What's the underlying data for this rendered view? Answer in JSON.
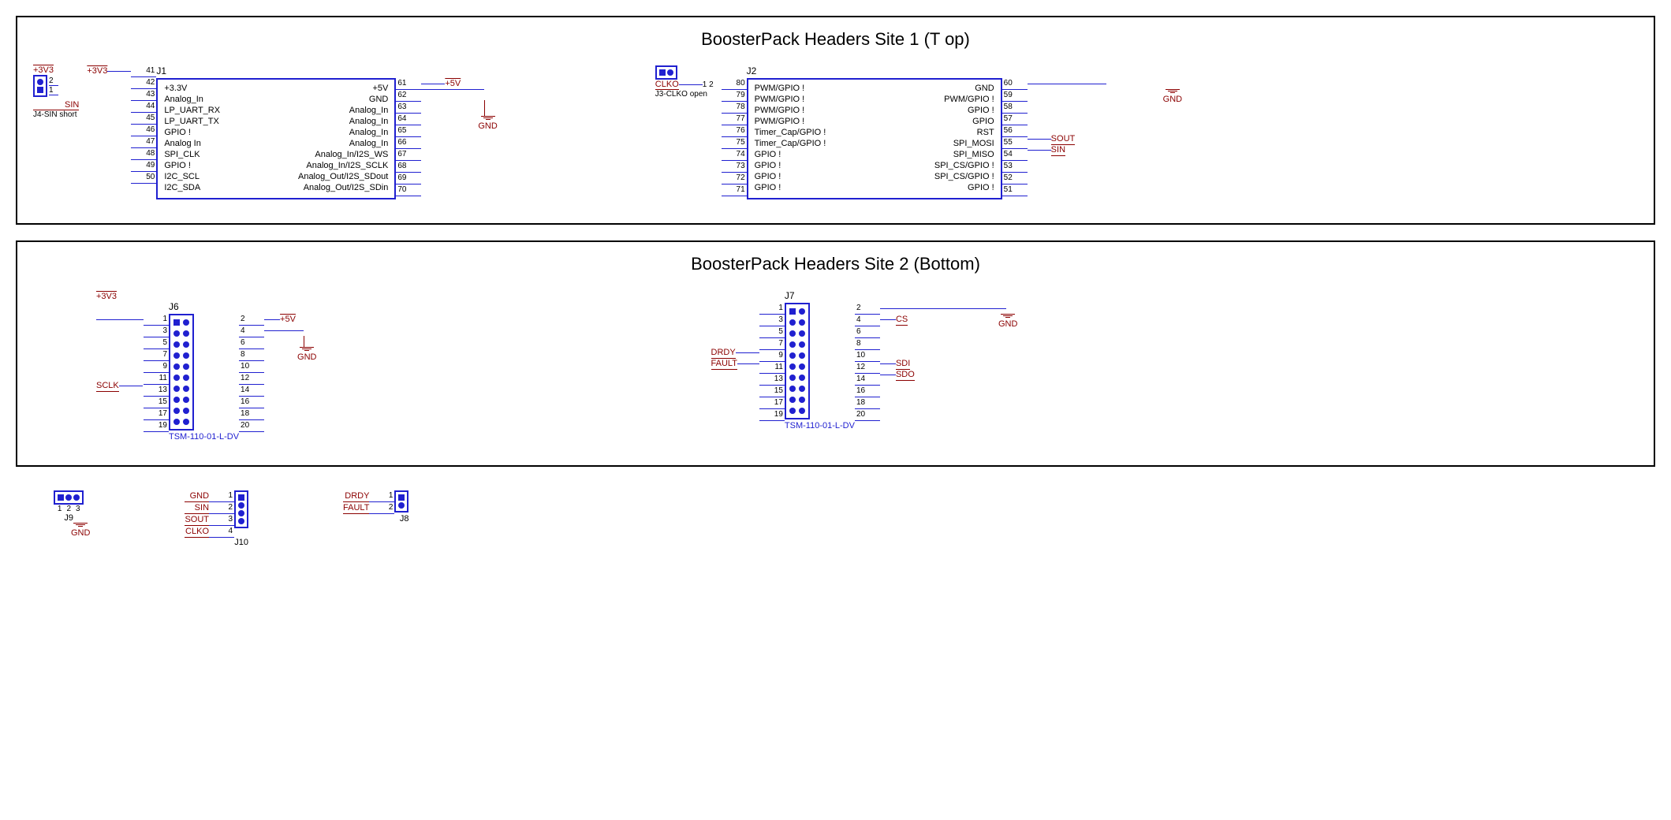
{
  "site1": {
    "title": "BoosterPack Headers Site 1 (T   op)",
    "j4_note": "J4-SIN short",
    "v33": "+3V3",
    "v5": "+5V",
    "sin": "SIN",
    "gnd": "GND",
    "clko": "CLKO",
    "j3_note": "J3-CLKO open",
    "sout": "SOUT",
    "J1": {
      "ref": "J1",
      "left_pins": [
        "41",
        "42",
        "43",
        "44",
        "45",
        "46",
        "47",
        "48",
        "49",
        "50"
      ],
      "left_labels": [
        "+3.3V",
        "Analog_In",
        "LP_UART_RX",
        "LP_UART_TX",
        "GPIO !",
        "Analog In",
        "SPI_CLK",
        "GPIO !",
        "I2C_SCL",
        "I2C_SDA"
      ],
      "right_labels": [
        "+5V",
        "GND",
        "Analog_In",
        "Analog_In",
        "Analog_In",
        "Analog_In",
        "Analog_In/I2S_WS",
        "Analog_In/I2S_SCLK",
        "Analog_Out/I2S_SDout",
        "Analog_Out/I2S_SDin"
      ],
      "right_pins": [
        "61",
        "62",
        "63",
        "64",
        "65",
        "66",
        "67",
        "68",
        "69",
        "70"
      ]
    },
    "J2": {
      "ref": "J2",
      "left_pins": [
        "80",
        "79",
        "78",
        "77",
        "76",
        "75",
        "74",
        "73",
        "72",
        "71"
      ],
      "left_labels": [
        "PWM/GPIO !",
        "PWM/GPIO !",
        "PWM/GPIO !",
        "PWM/GPIO !",
        "Timer_Cap/GPIO !",
        "Timer_Cap/GPIO !",
        "GPIO !",
        "GPIO !",
        "GPIO !",
        "GPIO !"
      ],
      "right_labels": [
        "GND",
        "PWM/GPIO !",
        "GPIO !",
        "GPIO",
        "RST",
        "SPI_MOSI",
        "SPI_MISO",
        "SPI_CS/GPIO !",
        "SPI_CS/GPIO !",
        "GPIO !"
      ],
      "right_pins": [
        "60",
        "59",
        "58",
        "57",
        "56",
        "55",
        "54",
        "53",
        "52",
        "51"
      ]
    }
  },
  "site2": {
    "title": "BoosterPack Headers Site 2 (Bottom)",
    "v33": "+3V3",
    "v5": "+5V",
    "gnd": "GND",
    "sclk": "SCLK",
    "cs": "CS",
    "drdy": "DRDY",
    "fault": "FAULT",
    "sdi": "SDI",
    "sdo": "SDO",
    "J6": {
      "ref": "J6",
      "part": "TSM-110-01-L-DV",
      "left_pins": [
        "1",
        "3",
        "5",
        "7",
        "9",
        "11",
        "13",
        "15",
        "17",
        "19"
      ],
      "right_pins": [
        "2",
        "4",
        "6",
        "8",
        "10",
        "12",
        "14",
        "16",
        "18",
        "20"
      ]
    },
    "J7": {
      "ref": "J7",
      "part": "TSM-110-01-L-DV",
      "left_pins": [
        "1",
        "3",
        "5",
        "7",
        "9",
        "11",
        "13",
        "15",
        "17",
        "19"
      ],
      "right_pins": [
        "2",
        "4",
        "6",
        "8",
        "10",
        "12",
        "14",
        "16",
        "18",
        "20"
      ]
    }
  },
  "floor": {
    "J9": {
      "ref": "J9",
      "gnd": "GND",
      "pins": [
        "1",
        "2",
        "3"
      ]
    },
    "J10": {
      "ref": "J10",
      "labels": [
        "GND",
        "SIN",
        "SOUT",
        "CLKO"
      ],
      "pins": [
        "1",
        "2",
        "3",
        "4"
      ]
    },
    "J8": {
      "ref": "J8",
      "labels": [
        "DRDY",
        "FAULT"
      ],
      "pins": [
        "1",
        "2"
      ]
    }
  }
}
